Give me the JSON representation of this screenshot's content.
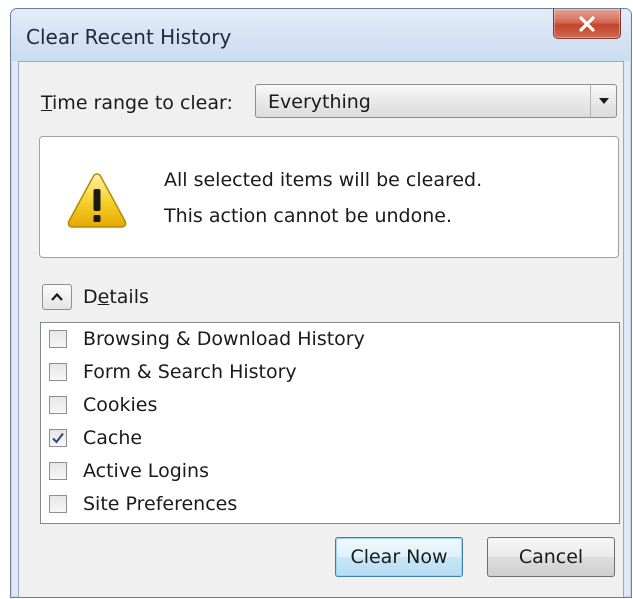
{
  "window": {
    "title": "Clear Recent History",
    "close_icon": "close-icon"
  },
  "time_range": {
    "label_prefix": "T",
    "label_rest": "ime range to clear:",
    "selected": "Everything"
  },
  "warning": {
    "icon": "warning-icon",
    "line1": "All selected items will be cleared.",
    "line2": "This action cannot be undone."
  },
  "details": {
    "label_a": "D",
    "label_u": "e",
    "label_b": "tails",
    "expanded": true
  },
  "items": [
    {
      "label": "Browsing & Download History",
      "checked": false
    },
    {
      "label": "Form & Search History",
      "checked": false
    },
    {
      "label": "Cookies",
      "checked": false
    },
    {
      "label": "Cache",
      "checked": true
    },
    {
      "label": "Active Logins",
      "checked": false
    },
    {
      "label": "Site Preferences",
      "checked": false
    }
  ],
  "buttons": {
    "clear_now": "Clear Now",
    "cancel": "Cancel"
  },
  "colors": {
    "close_button": "#c0452c",
    "warning_yellow": "#f5c400",
    "default_button_border": "#3c7fb1"
  }
}
